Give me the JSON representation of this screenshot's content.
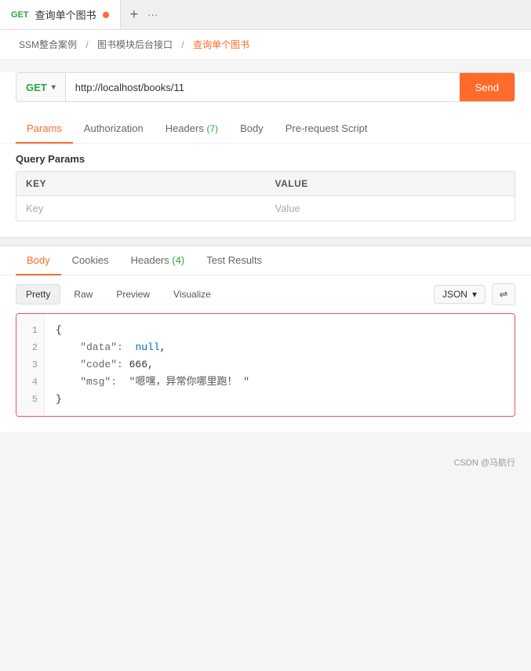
{
  "tab": {
    "method": "GET",
    "title": "查询单个图书",
    "dot_color": "#ff6b2b"
  },
  "breadcrumb": {
    "parts": [
      "SSM整合案例",
      "图书模块后台接口",
      "查询单个图书"
    ],
    "separator": "/"
  },
  "url_bar": {
    "method": "GET",
    "url": "http://localhost/books/11",
    "send_label": "Send"
  },
  "request_tabs": [
    {
      "label": "Params",
      "active": true
    },
    {
      "label": "Authorization"
    },
    {
      "label": "Headers",
      "badge": "7"
    },
    {
      "label": "Body"
    },
    {
      "label": "Pre-request Script"
    }
  ],
  "query_params": {
    "section_title": "Query Params",
    "headers": [
      "KEY",
      "VALUE"
    ],
    "rows": [
      {
        "key": "Key",
        "value": "Value"
      }
    ]
  },
  "response_tabs": [
    {
      "label": "Body",
      "active": true
    },
    {
      "label": "Cookies"
    },
    {
      "label": "Headers",
      "badge": "4"
    },
    {
      "label": "Test Results"
    }
  ],
  "format_bar": {
    "options": [
      "Pretty",
      "Raw",
      "Preview",
      "Visualize"
    ],
    "active": "Pretty",
    "format_type": "JSON"
  },
  "json_response": {
    "lines": [
      {
        "num": 1,
        "content": "{"
      },
      {
        "num": 2,
        "content": "    \"data\":  null,"
      },
      {
        "num": 3,
        "content": "    \"code\": 666,"
      },
      {
        "num": 4,
        "content": "    \"msg\":  \"嗯嘿，异常你哪里跑！ \""
      },
      {
        "num": 5,
        "content": "}"
      }
    ]
  },
  "footer": {
    "text": "CSDN @马航行"
  }
}
